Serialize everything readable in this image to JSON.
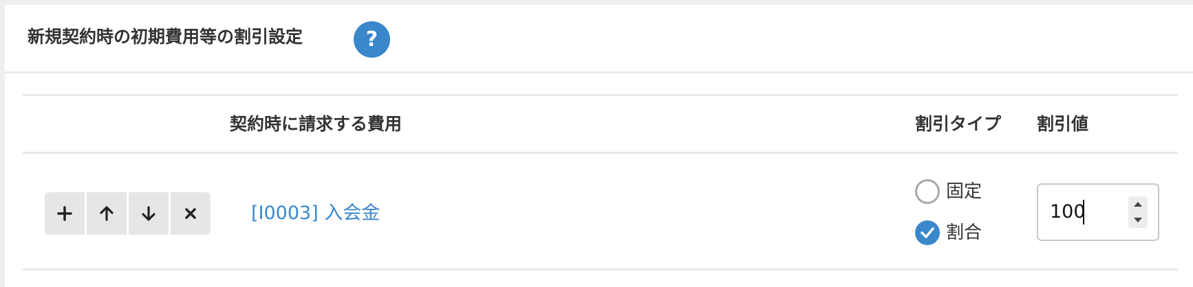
{
  "panel": {
    "title": "新規契約時の初期費用等の割引設定",
    "help_label": "?"
  },
  "table": {
    "headers": {
      "item": "契約時に請求する費用",
      "discount_type": "割引タイプ",
      "discount_value": "割引値"
    },
    "rows": [
      {
        "buttons": [
          "plus-icon",
          "arrow-up-icon",
          "arrow-down-icon",
          "close-icon"
        ],
        "item_label": "[I0003] 入会金",
        "discount_type_options": [
          {
            "label": "固定",
            "selected": false
          },
          {
            "label": "割合",
            "selected": true
          }
        ],
        "discount_value": "100"
      }
    ]
  },
  "colors": {
    "accent": "#3a87cc",
    "border": "#e9e9e9",
    "button_bg": "#e6e6e6",
    "text": "#333333"
  }
}
